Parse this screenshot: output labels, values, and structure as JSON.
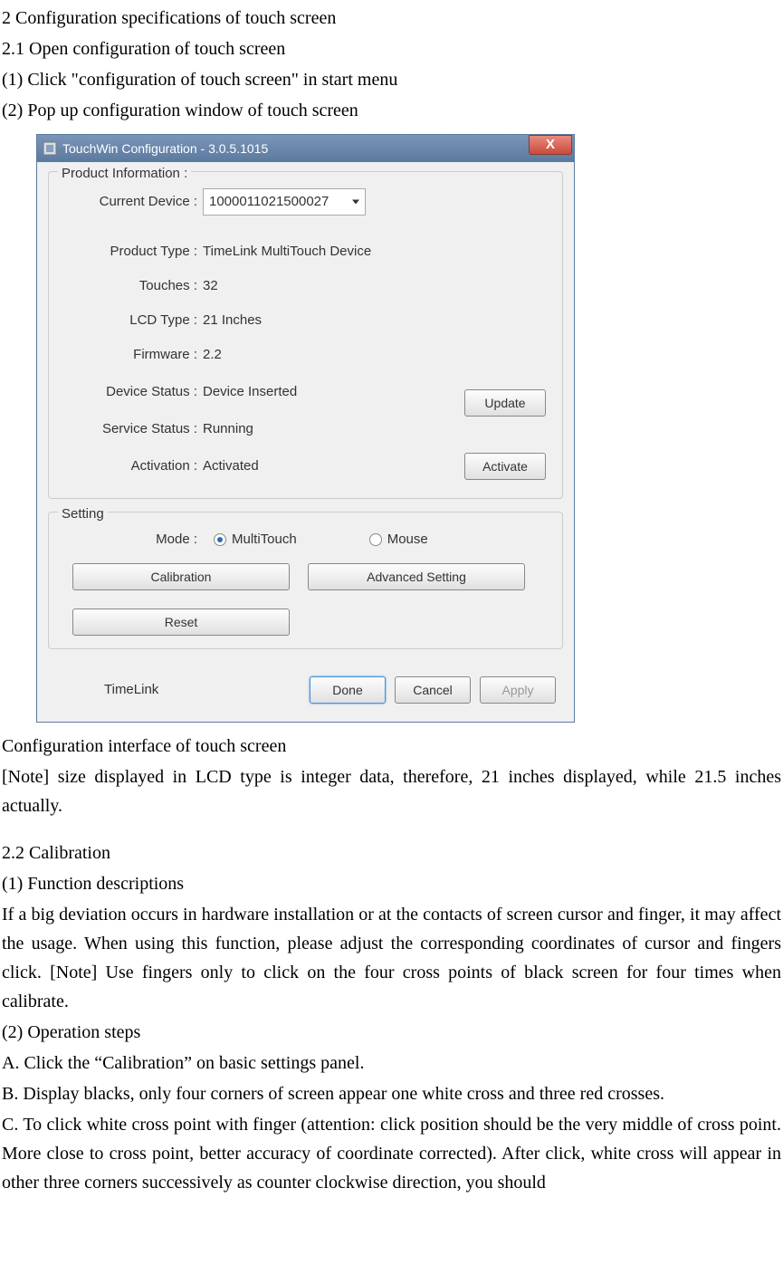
{
  "doc": {
    "h2": "2 Configuration specifications of touch screen",
    "h21": "2.1 Open configuration of touch screen",
    "step1": "(1) Click \"configuration of touch screen\" in start menu",
    "step2": "(2) Pop up configuration window of touch screen",
    "caption": "Configuration interface of touch screen",
    "note": "[Note] size displayed in LCD type is integer data, therefore, 21 inches displayed, while 21.5 inches actually.",
    "h22": "2.2 Calibration",
    "fndesc_title": "(1) Function descriptions",
    "fndesc_body": "If a big deviation occurs in hardware installation or at the contacts of screen cursor and finger, it may affect the usage. When using this function, please adjust the corresponding coordinates of cursor and fingers click. [Note] Use fingers only to click on the four cross points of black screen for four times when calibrate.",
    "ops_title": "(2) Operation steps",
    "opA": "A. Click the “Calibration” on basic settings panel.",
    "opB": "B. Display blacks, only four corners of screen appear one white cross and three red crosses.",
    "opC": "C. To click white cross point with finger (attention: click position should be the very middle of cross point. More close to cross point, better accuracy of coordinate corrected). After click, white cross will appear in other three corners successively as counter clockwise direction, you should"
  },
  "dialog": {
    "title": "TouchWin Configuration - 3.0.5.1015",
    "close": "X",
    "product_info_legend": "Product Information :",
    "current_device_label": "Current Device :",
    "current_device_value": "1000011021500027",
    "product_type_label": "Product Type :",
    "product_type_value": "TimeLink MultiTouch Device",
    "touches_label": "Touches :",
    "touches_value": "32",
    "lcd_label": "LCD Type :",
    "lcd_value": "21 Inches",
    "firmware_label": "Firmware :",
    "firmware_value": "2.2",
    "device_status_label": "Device Status :",
    "device_status_value": "Device Inserted",
    "service_status_label": "Service Status :",
    "service_status_value": "Running",
    "activation_label": "Activation :",
    "activation_value": "Activated",
    "update_btn": "Update",
    "activate_btn": "Activate",
    "setting_legend": "Setting",
    "mode_label": "Mode :",
    "mode_multi": "MultiTouch",
    "mode_mouse": "Mouse",
    "calibration_btn": "Calibration",
    "advanced_btn": "Advanced Setting",
    "reset_btn": "Reset",
    "footer_name": "TimeLink",
    "done_btn": "Done",
    "cancel_btn": "Cancel",
    "apply_btn": "Apply"
  }
}
